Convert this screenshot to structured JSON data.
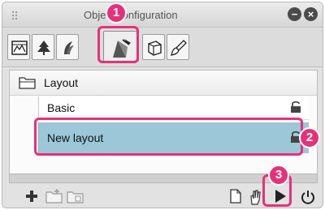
{
  "window": {
    "title": "Object configuration",
    "minimize_icon": "minus-icon",
    "close_icon": "close-icon"
  },
  "tabs": [
    {
      "name": "tab-frame",
      "icon": "frame-icon",
      "active": false
    },
    {
      "name": "tab-trees",
      "icon": "tree-icon",
      "active": false
    },
    {
      "name": "tab-plants",
      "icon": "plant-icon",
      "active": false
    },
    {
      "name": "tab-object",
      "icon": "object-icon",
      "active": true
    },
    {
      "name": "tab-3d",
      "icon": "cube-icon",
      "active": false
    },
    {
      "name": "tab-brush",
      "icon": "brush-icon",
      "active": false
    }
  ],
  "callouts": [
    "1",
    "2",
    "3"
  ],
  "tree": {
    "folder": {
      "label": "Layout",
      "icon": "folder-icon"
    },
    "items": [
      {
        "label": "Basic",
        "locked": true,
        "selected": false
      },
      {
        "label": "New layout",
        "locked": true,
        "selected": true
      }
    ]
  },
  "bottom_toolbar": [
    {
      "name": "add-button",
      "icon": "plus-icon"
    },
    {
      "name": "new-folder-button",
      "icon": "folder-add-icon"
    },
    {
      "name": "open-folder-button",
      "icon": "folder-open-icon"
    },
    {
      "name": "document-button",
      "icon": "document-icon"
    },
    {
      "name": "hand-button",
      "icon": "hand-icon"
    },
    {
      "name": "play-button",
      "icon": "play-icon"
    },
    {
      "name": "reset-button",
      "icon": "reset-icon"
    }
  ],
  "colors": {
    "highlight": "#e6317a",
    "selection": "#9bc7d8"
  }
}
